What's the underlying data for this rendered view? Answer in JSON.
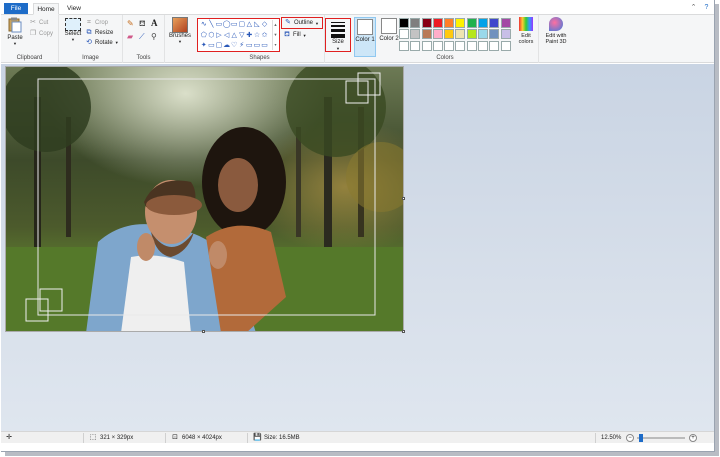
{
  "tabs": {
    "file": "File",
    "home": "Home",
    "view": "View"
  },
  "clipboard": {
    "paste": "Paste",
    "cut": "Cut",
    "copy": "Copy",
    "label": "Clipboard"
  },
  "image": {
    "select": "Select",
    "crop": "Crop",
    "resize": "Resize",
    "rotate": "Rotate",
    "label": "Image"
  },
  "tools": {
    "label": "Tools"
  },
  "brushes": {
    "label": "Brushes"
  },
  "shapes": {
    "label": "Shapes",
    "outline": "Outline",
    "fill": "Fill",
    "glyphs": [
      "∿",
      "╲",
      "▭",
      "◯",
      "▭",
      "▢",
      "△",
      "◺",
      "◇",
      "⬠",
      "⬡",
      "▷",
      "◁",
      "△",
      "▽",
      "✚",
      "☆",
      "✩",
      "✦",
      "▭",
      "▢",
      "☁",
      "♡",
      "⚡",
      "▭",
      "▭",
      "▭"
    ]
  },
  "size": {
    "label": "Size"
  },
  "colors": {
    "color1": "Color 1",
    "color2": "Color 2",
    "label": "Colors",
    "edit": "Edit colors",
    "paint3d": "Edit with Paint 3D",
    "color1_swatch": "#ffffff",
    "color2_swatch": "#ffffff",
    "palette": [
      "#000000",
      "#7f7f7f",
      "#880015",
      "#ed1c24",
      "#ff7f27",
      "#fff200",
      "#22b14c",
      "#00a2e8",
      "#3f48cc",
      "#a349a4",
      "#ffffff",
      "#c3c3c3",
      "#b97a57",
      "#ffaec9",
      "#ffc90e",
      "#efe4b0",
      "#b5e61d",
      "#99d9ea",
      "#7092be",
      "#c8bfe7",
      "#ffffff",
      "#ffffff",
      "#ffffff",
      "#ffffff",
      "#ffffff",
      "#ffffff",
      "#ffffff",
      "#ffffff",
      "#ffffff",
      "#ffffff"
    ]
  },
  "status": {
    "selection": "321 × 329px",
    "image_size": "6048 × 4024px",
    "file_size": "Size: 16.5MB",
    "zoom": "12.50%",
    "zoom_fraction": 0.05
  }
}
